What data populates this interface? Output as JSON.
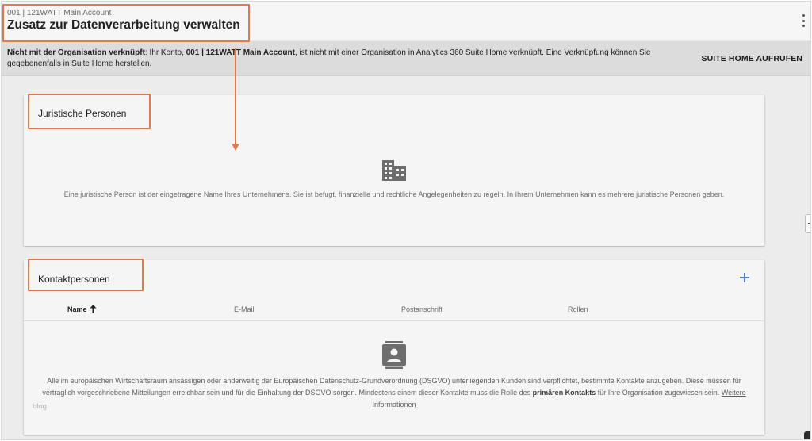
{
  "header": {
    "breadcrumb": "001 | 121WATT Main Account",
    "title": "Zusatz zur Datenverarbeitung verwalten"
  },
  "banner": {
    "strong_prefix": "Nicht mit der Organisation verknüpft",
    "text_1": ": Ihr Konto, ",
    "account": "001 | 121WATT Main Account",
    "text_2": ", ist nicht mit einer Organisation in Analytics 360 Suite Home verknüpft. Eine Verknüpfung können Sie gegebenenfalls in Suite Home herstellen.",
    "action_label": "SUITE HOME AUFRUFEN"
  },
  "legal_entities": {
    "title": "Juristische Personen",
    "description": "Eine juristische Person ist der eingetragene Name Ihres Unternehmens. Sie ist befugt, finanzielle und rechtliche Angelegenheiten zu regeln. In Ihrem Unternehmen kann es mehrere juristische Personen geben."
  },
  "contacts": {
    "title": "Kontaktpersonen",
    "columns": [
      "Name",
      "E-Mail",
      "Postanschrift",
      "Rollen"
    ],
    "desc_1": "Alle im europäischen Wirtschaftsraum ansässigen oder anderweitig der Europäischen Datenschutz-Grundverordnung (DSGVO) unterliegenden Kunden sind verpflichtet, bestimmte Kontakte anzugeben. Diese müssen für vertraglich vorgeschriebene Mitteilungen erreichbar sein und für die Einhaltung der DSGVO sorgen. Mindestens einem dieser Kontakte muss die Rolle des ",
    "desc_bold": "primären Kontakts",
    "desc_2": " für Ihre Organisation zugewiesen sein. ",
    "more_link": "Weitere Informationen"
  },
  "watermark": "blog",
  "colors": {
    "highlight": "#e07a4b",
    "add_icon": "#4a7fd4",
    "page_background": "#ececec"
  },
  "icons": {
    "menu": "more-vert-icon",
    "building": "business-icon",
    "contact": "contact-card-icon",
    "add": "plus-icon",
    "sort": "arrow-up-icon"
  }
}
